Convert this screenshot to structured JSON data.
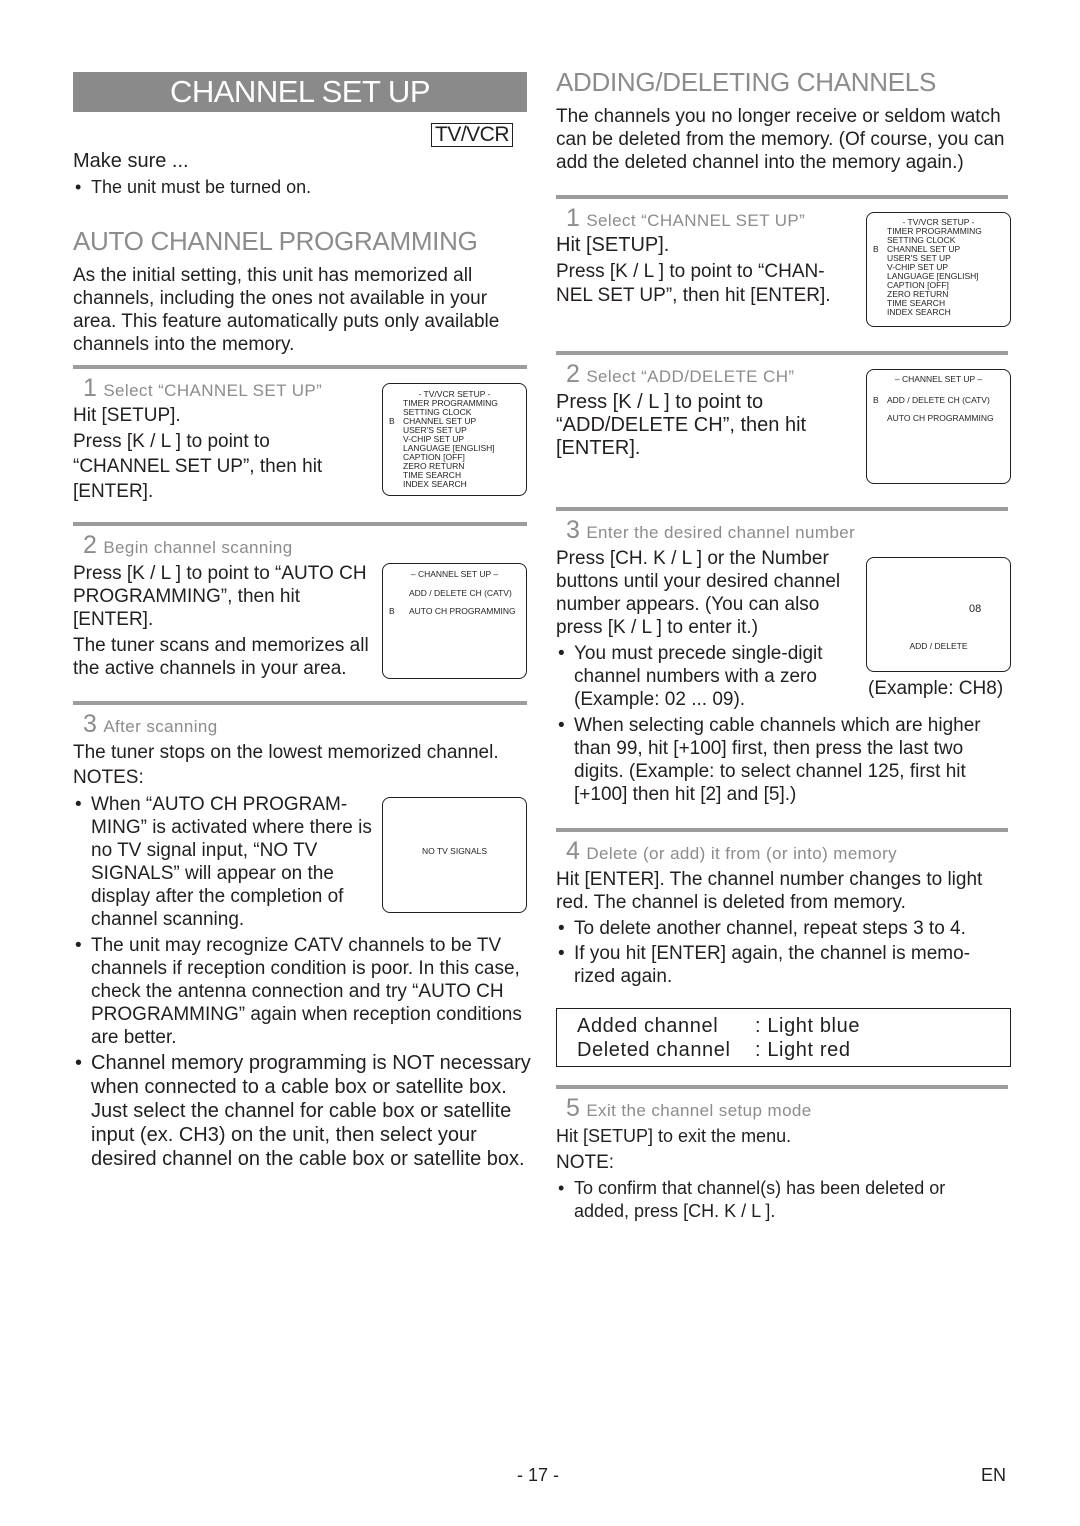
{
  "page": {
    "title": "CHANNEL SET UP",
    "badge": "TV/VCR",
    "page_number": "- 17 -",
    "language": "EN"
  },
  "make_sure": {
    "heading": "Make sure ...",
    "items": [
      "The unit must be turned on."
    ]
  },
  "auto": {
    "heading": "AUTO CHANNEL PROGRAMMING",
    "intro": "As the initial setting, this unit has memorized all channels, including the ones not available in your area. This feature automatically puts only available channels into the memory.",
    "steps": [
      {
        "num": "1",
        "title": "Select “CHANNEL SET UP”",
        "lines": [
          "Hit [SETUP].",
          "Press [K / L ] to point to “CHANNEL SET UP”, then hit [ENTER]."
        ]
      },
      {
        "num": "2",
        "title": "Begin channel scanning",
        "lines": [
          "Press [K / L ] to point to “AUTO CH PROGRAMMING”, then hit [ENTER].",
          "The tuner scans and memorizes all the active channels in your area."
        ]
      },
      {
        "num": "3",
        "title": "After scanning",
        "lines": [
          "The tuner stops on the lowest memorized channel."
        ]
      }
    ],
    "notes_heading": "NOTES:",
    "notes": [
      "When “AUTO CH PROGRAM-MING” is activated where there is no TV signal input, “NO TV SIGNALS” will appear on the display after the completion of channel scanning.",
      "The unit may recognize CATV channels to be TV channels if reception condition is poor. In this case, check the antenna connection and try “AUTO CH PROGRAMMING” again when reception conditions are better.",
      "Channel memory programming is NOT necessary when connected to a cable box or satellite box. Just select the channel for cable box or satellite input (ex. CH3) on the unit, then select your desired channel on the cable box or satellite box."
    ]
  },
  "screens": {
    "tvvcr_setup": {
      "title": "- TV/VCR SETUP -",
      "cursor": "B",
      "items": [
        "TIMER PROGRAMMING",
        "SETTING CLOCK",
        "CHANNEL SET UP",
        "USER'S SET UP",
        "V-CHIP SET UP",
        "LANGUAGE  [ENGLISH]",
        "CAPTION  [OFF]",
        "ZERO RETURN",
        "TIME SEARCH",
        "INDEX SEARCH"
      ],
      "selected_index": 2
    },
    "channel_setup": {
      "title": "– CHANNEL SET UP –",
      "cursor": "B",
      "items": [
        "ADD / DELETE CH (CATV)",
        "AUTO CH PROGRAMMING"
      ]
    },
    "no_signal": {
      "text": "NO TV SIGNALS"
    },
    "add_delete": {
      "channel": "08",
      "label": "ADD / DELETE",
      "caption": "(Example: CH8)"
    }
  },
  "adddel": {
    "heading": "ADDING/DELETING CHANNELS",
    "intro": "The channels you no longer receive or seldom watch can be deleted from the memory. (Of course, you can add the deleted channel into the memory again.)",
    "steps": [
      {
        "num": "1",
        "title": "Select “CHANNEL SET UP”",
        "lines": [
          "Hit [SETUP].",
          "Press [K / L ] to point to “CHAN-NEL SET UP”, then hit [ENTER]."
        ]
      },
      {
        "num": "2",
        "title": "Select “ADD/DELETE CH”",
        "lines": [
          "Press [K / L ] to point to “ADD/DELETE CH”, then hit [ENTER]."
        ]
      },
      {
        "num": "3",
        "title": "Enter the desired channel number",
        "lines": [
          "Press [CH. K / L ] or the Number buttons until your desired channel number appears. (You can also press [K / L ] to enter it.)"
        ],
        "bullets": [
          "You must precede single-digit channel numbers with a zero (Example: 02 ...  09).",
          "When selecting cable channels which are higher than 99, hit [+100] first, then press the last two digits. (Example: to select channel 125, first hit [+100] then hit [2] and [5].)"
        ]
      },
      {
        "num": "4",
        "title": "Delete (or add) it from (or into) memory",
        "lines": [
          "Hit [ENTER]. The channel number changes to light red. The channel is deleted from memory."
        ],
        "bullets": [
          "To delete another channel, repeat steps 3 to 4.",
          "If you hit [ENTER] again, the channel is memo-rized again."
        ]
      },
      {
        "num": "5",
        "title": "Exit the channel setup mode",
        "lines": [
          "Hit [SETUP] to exit the menu."
        ],
        "note_heading": "NOTE:",
        "bullets": [
          "To confirm that channel(s) has been deleted or added, press [CH. K / L ]."
        ]
      }
    ],
    "legend": [
      {
        "label": "Added channel",
        "value": ": Light blue"
      },
      {
        "label": "Deleted channel",
        "value": ": Light red"
      }
    ]
  }
}
